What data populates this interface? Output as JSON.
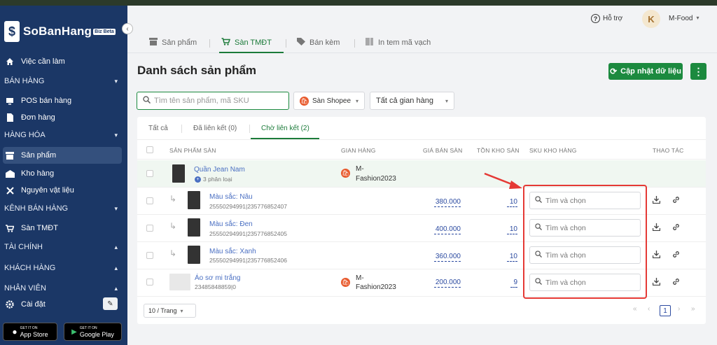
{
  "app": {
    "name": "SoBanHang",
    "badge": "Biz Beta"
  },
  "sidebar": {
    "items": [
      {
        "label": "Việc cần làm",
        "icon": "home-icon"
      },
      {
        "label": "BÁN HÀNG",
        "section": true,
        "caret": "⌄"
      },
      {
        "label": "POS bán hàng",
        "icon": "monitor-icon"
      },
      {
        "label": "Đơn hàng",
        "icon": "document-icon"
      },
      {
        "label": "HÀNG HÓA",
        "section": true,
        "caret": "⌄"
      },
      {
        "label": "Sản phẩm",
        "icon": "box-icon",
        "active": true
      },
      {
        "label": "Kho hàng",
        "icon": "warehouse-icon"
      },
      {
        "label": "Nguyên vật liệu",
        "icon": "utensils-icon"
      },
      {
        "label": "KÊNH BÁN HÀNG",
        "section": true,
        "caret": "⌄"
      },
      {
        "label": "Sàn TMĐT",
        "icon": "cart-icon"
      },
      {
        "label": "TÀI CHÍNH",
        "section": true,
        "caret": "^"
      },
      {
        "label": "KHÁCH HÀNG",
        "section": true,
        "caret": "^"
      },
      {
        "label": "NHÂN VIÊN",
        "section": true,
        "caret": "^"
      },
      {
        "label": "Cài đặt",
        "icon": "gear-icon"
      }
    ],
    "appstore": {
      "small": "GET IT ON",
      "label": "App Store"
    },
    "googleplay": {
      "small": "GET IT ON",
      "label": "Google Play"
    }
  },
  "header": {
    "help": "Hỗ trợ",
    "user": "M-Food",
    "avatar": "K"
  },
  "toptabs": [
    "Sản phẩm",
    "Sàn TMĐT",
    "Bán kèm",
    "In tem mã vạch"
  ],
  "page": {
    "title": "Danh sách sản phẩm",
    "update_btn": "Cập nhật dữ liệu",
    "more": "⋮"
  },
  "filters": {
    "search_placeholder": "Tìm tên sản phẩm, mã SKU",
    "platform": "Sàn Shopee",
    "store": "Tất cả gian hàng"
  },
  "subtabs": [
    "Tất cả",
    "Đã liên kết (0)",
    "Chờ liên kết (2)"
  ],
  "columns": [
    "SẢN PHẨM SÀN",
    "GIAN HÀNG",
    "GIÁ BÁN SÀN",
    "TỒN KHO SÀN",
    "SKU KHO HÀNG",
    "THAO TÁC"
  ],
  "rows": [
    {
      "name": "Quần Jean Nam",
      "sub": "3 phân loại",
      "shop_line1": "M-",
      "shop_line2": "Fashion2023",
      "parent": true
    },
    {
      "name": "Màu sắc: Nâu",
      "sku": "25550294991|235776852407",
      "price": "380.000",
      "stock": "10",
      "placeholder": "Tìm và chọn"
    },
    {
      "name": "Màu sắc: Đen",
      "sku": "25550294991|235776852405",
      "price": "400.000",
      "stock": "10",
      "placeholder": "Tìm và chọn"
    },
    {
      "name": "Màu sắc: Xanh",
      "sku": "25550294991|235776852406",
      "price": "360.000",
      "stock": "10",
      "placeholder": "Tìm và chọn"
    },
    {
      "name": "Áo sơ mi trắng",
      "sku": "23485848859|0",
      "shop_line1": "M-",
      "shop_line2": "Fashion2023",
      "price": "200.000",
      "stock": "9",
      "placeholder": "Tìm và chọn"
    }
  ],
  "pager": {
    "size": "10 / Trang",
    "current": "1"
  }
}
